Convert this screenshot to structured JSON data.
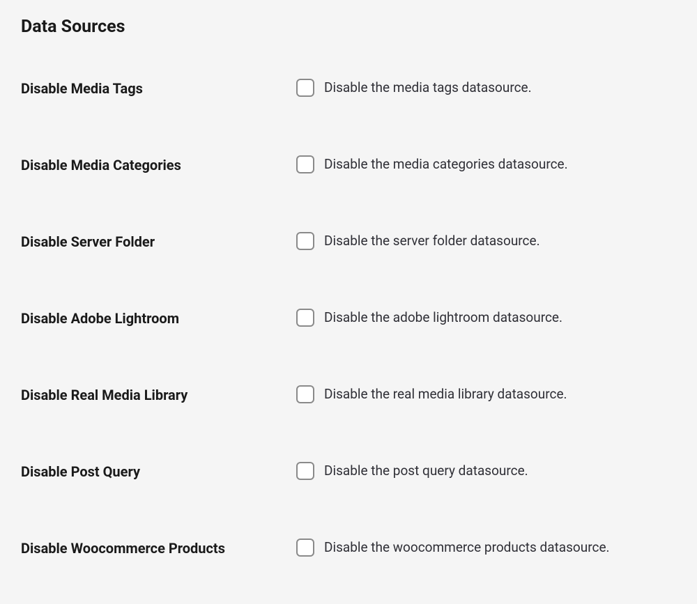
{
  "section": {
    "title": "Data Sources"
  },
  "settings": {
    "media_tags": {
      "label": "Disable Media Tags",
      "description": "Disable the media tags datasource.",
      "checked": false
    },
    "media_categories": {
      "label": "Disable Media Categories",
      "description": "Disable the media categories datasource.",
      "checked": false
    },
    "server_folder": {
      "label": "Disable Server Folder",
      "description": "Disable the server folder datasource.",
      "checked": false
    },
    "adobe_lightroom": {
      "label": "Disable Adobe Lightroom",
      "description": "Disable the adobe lightroom datasource.",
      "checked": false
    },
    "real_media_library": {
      "label": "Disable Real Media Library",
      "description": "Disable the real media library datasource.",
      "checked": false
    },
    "post_query": {
      "label": "Disable Post Query",
      "description": "Disable the post query datasource.",
      "checked": false
    },
    "woocommerce_products": {
      "label": "Disable Woocommerce Products",
      "description": "Disable the woocommerce products datasource.",
      "checked": false
    }
  }
}
